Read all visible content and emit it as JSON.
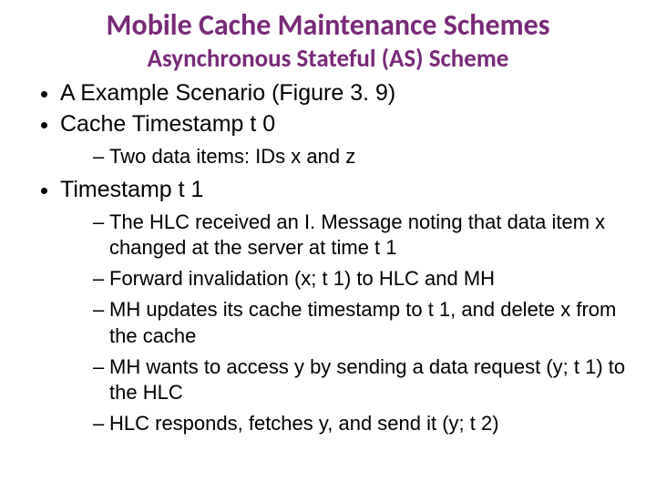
{
  "title": "Mobile Cache Maintenance Schemes",
  "subtitle": "Asynchronous Stateful (AS) Scheme",
  "bullets": [
    {
      "text": "A Example Scenario (Figure 3. 9)"
    },
    {
      "text": "Cache Timestamp t 0",
      "sub": [
        "Two data items: IDs x and z"
      ]
    },
    {
      "text": "Timestamp t 1",
      "sub": [
        "The HLC received an I. Message noting that data item x changed at the server at time t 1",
        "Forward invalidation (x; t 1) to HLC and MH",
        "MH updates its cache timestamp to t 1, and delete x from the cache",
        "MH wants to access y by sending a data request (y; t 1) to the HLC",
        "HLC responds, fetches y, and send it (y; t 2)"
      ]
    }
  ]
}
